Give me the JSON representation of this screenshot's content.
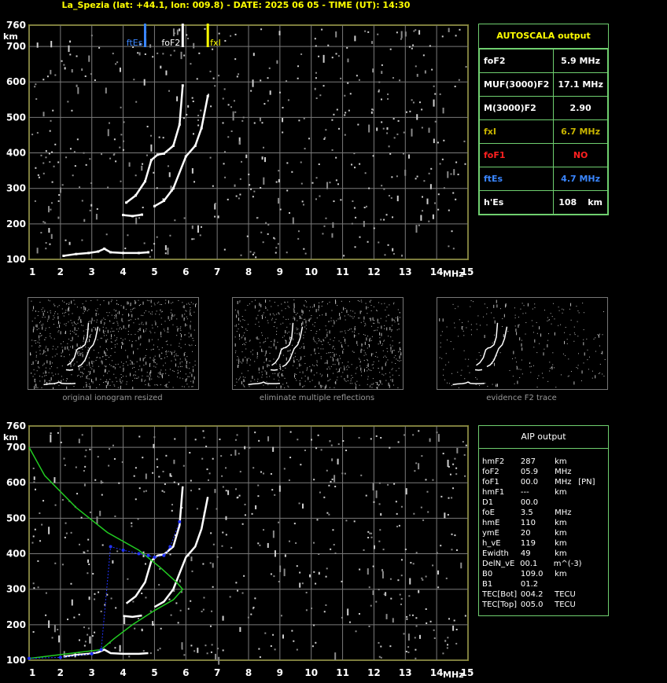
{
  "header": {
    "title": "La_Spezia (lat: +44.1, lon: 009.8) - DATE: 2025 06 05 - TIME (UT): 14:30"
  },
  "colors": {
    "frame": "#ffff00",
    "grid": "#7a7a7a",
    "panel_border": "#6fcf6f",
    "ftEs": "#3a86ff",
    "fxI": "#ffff00",
    "foF1": "#ff2020",
    "green_profile": "#22cc22",
    "blue_profile": "#2233ff"
  },
  "chart_data": [
    {
      "type": "scatter",
      "title": "",
      "xlabel": "MHz",
      "ylabel": "km",
      "xlim": [
        1,
        15
      ],
      "ylim": [
        100,
        760
      ],
      "xticks": [
        "1",
        "2",
        "3",
        "4",
        "5",
        "6",
        "7",
        "8",
        "9",
        "10",
        "11",
        "12",
        "13",
        "14",
        "15"
      ],
      "yticks": [
        "100",
        "200",
        "300",
        "400",
        "500",
        "600",
        "700",
        "760"
      ],
      "grid": true,
      "markers": [
        {
          "label": "ftEs",
          "x": 4.7
        },
        {
          "label": "foF2",
          "x": 5.9
        },
        {
          "label": "fxI",
          "x": 6.7
        }
      ],
      "series": [
        {
          "x": [
            2.1,
            2.5,
            2.9,
            3.2,
            3.4,
            3.6,
            4.0,
            4.5,
            4.8
          ],
          "y": [
            110,
            115,
            118,
            122,
            130,
            120,
            118,
            118,
            120
          ]
        },
        {
          "x": [
            4.0,
            4.3,
            4.6
          ],
          "y": [
            225,
            222,
            226
          ]
        },
        {
          "x": [
            4.1,
            4.4,
            4.7,
            4.9,
            5.1,
            5.3,
            5.6,
            5.8,
            5.9
          ],
          "y": [
            260,
            280,
            320,
            380,
            395,
            398,
            420,
            480,
            590
          ]
        },
        {
          "x": [
            5.0,
            5.3,
            5.6,
            6.0,
            6.3,
            6.5,
            6.7
          ],
          "y": [
            250,
            265,
            300,
            390,
            420,
            470,
            560
          ]
        }
      ]
    },
    {
      "type": "line",
      "title": "",
      "xlabel": "MHz",
      "ylabel": "km",
      "xlim": [
        1,
        15
      ],
      "ylim": [
        100,
        760
      ],
      "xticks": [
        "1",
        "2",
        "3",
        "4",
        "5",
        "6",
        "7",
        "8",
        "9",
        "10",
        "11",
        "12",
        "13",
        "14",
        "15"
      ],
      "yticks": [
        "100",
        "200",
        "300",
        "400",
        "500",
        "600",
        "700",
        "760"
      ],
      "grid": true,
      "series": [
        {
          "x": [
            1.0,
            1.5,
            2.5,
            3.5,
            4.5,
            5.2,
            5.7,
            5.9,
            5.6,
            5.0,
            4.3,
            3.7,
            3.3,
            1.0
          ],
          "y": [
            700,
            620,
            530,
            460,
            410,
            360,
            320,
            300,
            270,
            240,
            200,
            160,
            130,
            105
          ]
        },
        {
          "x": [
            1.0,
            2.0,
            3.0,
            3.3,
            3.6,
            4.0,
            4.5,
            4.8,
            5.0,
            5.3,
            5.5,
            5.8
          ],
          "y": [
            105,
            108,
            118,
            130,
            420,
            410,
            400,
            395,
            390,
            395,
            420,
            490
          ]
        }
      ]
    }
  ],
  "autoscala": {
    "title": "AUTOSCALA output",
    "rows": [
      {
        "label": "foF2",
        "value": "5.9 MHz"
      },
      {
        "label": "MUF(3000)F2",
        "value": "17.1 MHz"
      },
      {
        "label": "M(3000)F2",
        "value": "2.90"
      },
      {
        "label": "fxI",
        "value": "6.7 MHz"
      },
      {
        "label": "foF1",
        "value": "NO"
      },
      {
        "label": "ftEs",
        "value": "4.7 MHz"
      },
      {
        "label": "h'Es",
        "value": "108",
        "unit": "km"
      }
    ]
  },
  "thumbs": [
    {
      "caption": "original ionogram resized"
    },
    {
      "caption": "eliminate multiple reflections"
    },
    {
      "caption": "evidence F2 trace"
    }
  ],
  "aip": {
    "title": "AIP output",
    "rows": [
      {
        "k": "hmF2",
        "v": "287",
        "u": "km",
        "x": ""
      },
      {
        "k": "foF2",
        "v": "05.9",
        "u": "MHz",
        "x": ""
      },
      {
        "k": "foF1",
        "v": "00.0",
        "u": "MHz",
        "x": "[PN]"
      },
      {
        "k": "hmF1",
        "v": "---",
        "u": "km",
        "x": ""
      },
      {
        "k": "D1",
        "v": "00.0",
        "u": "",
        "x": ""
      },
      {
        "k": "foE",
        "v": "3.5",
        "u": "MHz",
        "x": ""
      },
      {
        "k": "hmE",
        "v": "110",
        "u": "km",
        "x": ""
      },
      {
        "k": "ymE",
        "v": "20",
        "u": "km",
        "x": ""
      },
      {
        "k": "h_vE",
        "v": "119",
        "u": "km",
        "x": ""
      },
      {
        "k": "Ewidth",
        "v": "49",
        "u": "km",
        "x": ""
      },
      {
        "k": "DelN_vE",
        "v": "00.1",
        "u": "m^(-3)",
        "x": ""
      },
      {
        "k": "B0",
        "v": "109.0",
        "u": "km",
        "x": ""
      },
      {
        "k": "B1",
        "v": "01.2",
        "u": "",
        "x": ""
      },
      {
        "k": "TEC[Bot]",
        "v": "004.2",
        "u": "TECU",
        "x": ""
      },
      {
        "k": "TEC[Top]",
        "v": "005.0",
        "u": "TECU",
        "x": ""
      }
    ]
  }
}
